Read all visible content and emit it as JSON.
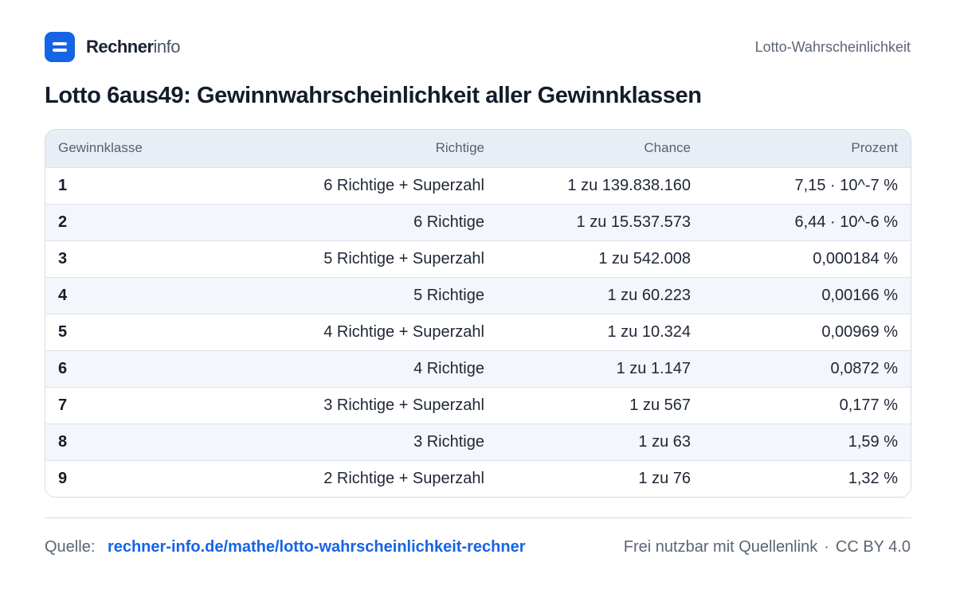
{
  "brand": {
    "name_bold": "Rechner",
    "name_light": "info",
    "page_label": "Lotto-Wahrscheinlichkeit"
  },
  "title": "Lotto 6aus49: Gewinnwahrscheinlichkeit aller Gewinnklassen",
  "table": {
    "headers": [
      "Gewinnklasse",
      "Richtige",
      "Chance",
      "Prozent"
    ],
    "rows": [
      [
        "1",
        "6 Richtige + Superzahl",
        "1 zu 139.838.160",
        "7,15 · 10^-7 %"
      ],
      [
        "2",
        "6 Richtige",
        "1 zu 15.537.573",
        "6,44 · 10^-6 %"
      ],
      [
        "3",
        "5 Richtige + Superzahl",
        "1 zu 542.008",
        "0,000184 %"
      ],
      [
        "4",
        "5 Richtige",
        "1 zu 60.223",
        "0,00166 %"
      ],
      [
        "5",
        "4 Richtige + Superzahl",
        "1 zu 10.324",
        "0,00969 %"
      ],
      [
        "6",
        "4 Richtige",
        "1 zu 1.147",
        "0,0872 %"
      ],
      [
        "7",
        "3 Richtige + Superzahl",
        "1 zu 567",
        "0,177 %"
      ],
      [
        "8",
        "3 Richtige",
        "1 zu 63",
        "1,59 %"
      ],
      [
        "9",
        "2 Richtige + Superzahl",
        "1 zu 76",
        "1,32 %"
      ]
    ]
  },
  "footer": {
    "source_label": "Quelle:",
    "source_link": "rechner-info.de/mathe/lotto-wahrscheinlichkeit-rechner",
    "license_text": "Frei nutzbar mit Quellenlink",
    "separator": "·",
    "license": "CC BY 4.0"
  },
  "colors": {
    "accent": "#1664e6",
    "header_bg": "#e8eef6",
    "row_alt": "#f3f6fa"
  },
  "icons": {
    "logo": "menu-lines-icon"
  }
}
